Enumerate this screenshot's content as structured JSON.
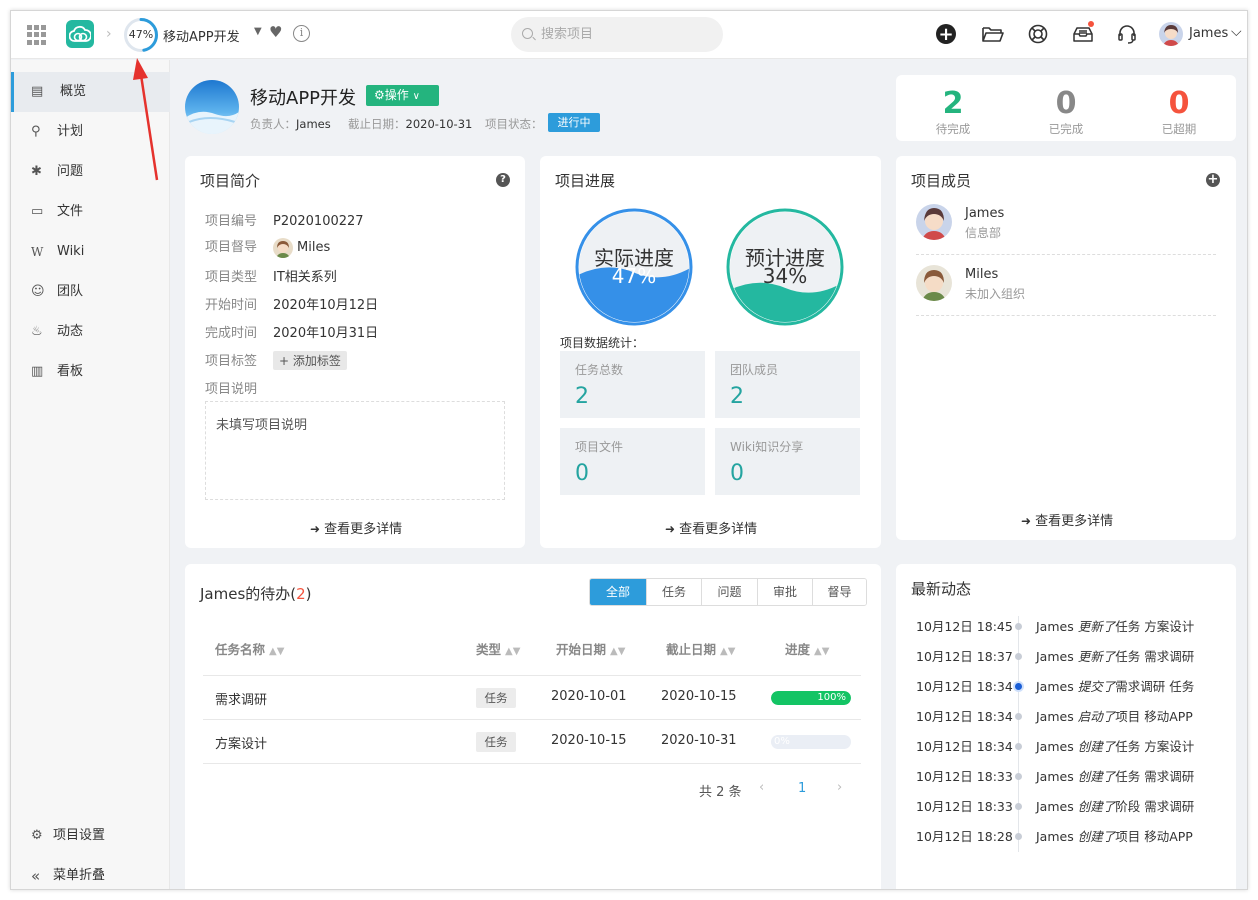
{
  "header": {
    "progress": "47%",
    "progress_fraction": 0.47,
    "project_name": "移动APP开发",
    "search_placeholder": "搜索项目",
    "user_name": "James"
  },
  "sidebar": {
    "items": [
      {
        "label": "概览",
        "icon": "overview-icon",
        "glyph": "▤"
      },
      {
        "label": "计划",
        "icon": "plan-icon",
        "glyph": "⚲"
      },
      {
        "label": "问题",
        "icon": "bug-icon",
        "glyph": "✱"
      },
      {
        "label": "文件",
        "icon": "folder-icon",
        "glyph": "▭"
      },
      {
        "label": "Wiki",
        "icon": "wiki-icon",
        "glyph": "W"
      },
      {
        "label": "团队",
        "icon": "team-icon",
        "glyph": "☺"
      },
      {
        "label": "动态",
        "icon": "activity-icon",
        "glyph": "♨"
      },
      {
        "label": "看板",
        "icon": "board-icon",
        "glyph": "▥"
      }
    ],
    "settings_label": "项目设置",
    "collapse_label": "菜单折叠"
  },
  "project": {
    "title": "移动APP开发",
    "op_label": "⚙操作",
    "owner_label": "负责人：",
    "owner": "James",
    "deadline_label": "截止日期：",
    "deadline": "2020-10-31",
    "status_label": "项目状态：",
    "status": "进行中"
  },
  "stats": {
    "pending": {
      "value": "2",
      "label": "待完成",
      "color": "#24b47e"
    },
    "done": {
      "value": "0",
      "label": "已完成",
      "color": "#888888"
    },
    "overdue": {
      "value": "0",
      "label": "已超期",
      "color": "#f5533d"
    }
  },
  "intro": {
    "title": "项目简介",
    "fields": [
      {
        "k": "项目编号",
        "v": "P2020100227"
      },
      {
        "k": "项目督导",
        "v": "Miles"
      },
      {
        "k": "项目类型",
        "v": "IT相关系列"
      },
      {
        "k": "开始时间",
        "v": "2020年10月12日"
      },
      {
        "k": "完成时间",
        "v": "2020年10月31日"
      },
      {
        "k": "项目标签",
        "v": "+ 添加标签"
      },
      {
        "k": "项目说明",
        "v": ""
      }
    ],
    "description": "未填写项目说明",
    "more": "查看更多详情"
  },
  "progress": {
    "title": "项目进展",
    "actual_label": "实际进度",
    "actual_value": "47%",
    "actual_fraction": 0.47,
    "expected_label": "预计进度",
    "expected_value": "34%",
    "expected_fraction": 0.34,
    "stats_label": "项目数据统计：",
    "boxes": [
      {
        "label": "任务总数",
        "value": "2"
      },
      {
        "label": "团队成员",
        "value": "2"
      },
      {
        "label": "项目文件",
        "value": "0"
      },
      {
        "label": "Wiki知识分享",
        "value": "0"
      }
    ],
    "more": "查看更多详情"
  },
  "members": {
    "title": "项目成员",
    "list": [
      {
        "name": "James",
        "dept": "信息部"
      },
      {
        "name": "Miles",
        "dept": "未加入组织"
      }
    ],
    "more": "查看更多详情"
  },
  "todo": {
    "title_prefix": "James的待办(",
    "count": "2",
    "title_suffix": ")",
    "tabs": [
      "全部",
      "任务",
      "问题",
      "审批",
      "督导"
    ],
    "columns": [
      "任务名称",
      "类型",
      "开始日期",
      "截止日期",
      "进度"
    ],
    "rows": [
      {
        "name": "需求调研",
        "type": "任务",
        "start": "2020-10-01",
        "end": "2020-10-15",
        "progress": "100%",
        "fraction": 1.0
      },
      {
        "name": "方案设计",
        "type": "任务",
        "start": "2020-10-15",
        "end": "2020-10-31",
        "progress": "0%",
        "fraction": 0.0
      }
    ],
    "total": "共 2 条",
    "page": "1"
  },
  "activity": {
    "title": "最新动态",
    "items": [
      {
        "time": "10月12日 18:45",
        "user": "James",
        "action": "更新了",
        "obj": "任务 方案设计"
      },
      {
        "time": "10月12日 18:37",
        "user": "James",
        "action": "更新了",
        "obj": "任务 需求调研"
      },
      {
        "time": "10月12日 18:34",
        "user": "James",
        "action": "提交了",
        "obj": "需求调研 任务"
      },
      {
        "time": "10月12日 18:34",
        "user": "James",
        "action": "启动了",
        "obj": "项目 移动APP"
      },
      {
        "time": "10月12日 18:34",
        "user": "James",
        "action": "创建了",
        "obj": "任务 方案设计"
      },
      {
        "time": "10月12日 18:33",
        "user": "James",
        "action": "创建了",
        "obj": "任务 需求调研"
      },
      {
        "time": "10月12日 18:33",
        "user": "James",
        "action": "创建了",
        "obj": "阶段 需求调研"
      },
      {
        "time": "10月12日 18:28",
        "user": "James",
        "action": "创建了",
        "obj": "项目 移动APP"
      }
    ]
  }
}
